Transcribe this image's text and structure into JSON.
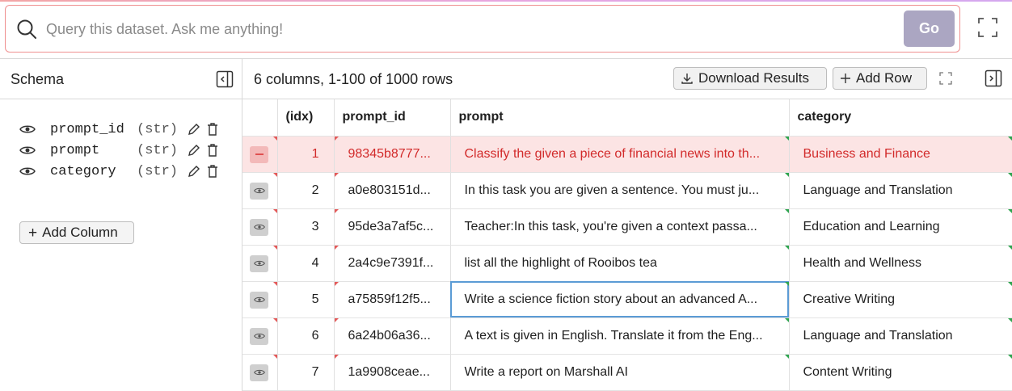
{
  "query": {
    "placeholder": "Query this dataset. Ask me anything!",
    "go_label": "Go"
  },
  "schema": {
    "title": "Schema",
    "columns": [
      {
        "name": "prompt_id",
        "type": "(str)"
      },
      {
        "name": "prompt",
        "type": "(str)"
      },
      {
        "name": "category",
        "type": "(str)"
      }
    ],
    "add_column_label": "Add Column"
  },
  "table": {
    "summary": "6 columns, 1-100 of 1000 rows",
    "download_label": "Download Results",
    "add_row_label": "Add Row",
    "headers": [
      "(idx)",
      "prompt_id",
      "prompt",
      "category"
    ],
    "rows": [
      {
        "idx": "1",
        "prompt_id": "98345b8777...",
        "prompt": "Classify the given a piece of financial news into th...",
        "category": "Business and Finance",
        "selected": true
      },
      {
        "idx": "2",
        "prompt_id": "a0e803151d...",
        "prompt": "In this task you are given a sentence. You must ju...",
        "category": "Language and Translation"
      },
      {
        "idx": "3",
        "prompt_id": "95de3a7af5c...",
        "prompt": "Teacher:In this task, you're given a context passa...",
        "category": "Education and Learning"
      },
      {
        "idx": "4",
        "prompt_id": "2a4c9e7391f...",
        "prompt": "list all the highlight of Rooibos tea",
        "category": "Health and Wellness"
      },
      {
        "idx": "5",
        "prompt_id": "a75859f12f5...",
        "prompt": "Write a science fiction story about an advanced A...",
        "category": "Creative Writing"
      },
      {
        "idx": "6",
        "prompt_id": "6a24b06a36...",
        "prompt": "A text is given in English. Translate it from the Eng...",
        "category": "Language and Translation"
      },
      {
        "idx": "7",
        "prompt_id": "1a9908ceae...",
        "prompt": "Write a report on Marshall AI",
        "category": "Content Writing"
      }
    ]
  },
  "colors": {
    "accent_go": "#aba6c2",
    "selected_row_bg": "#fce4e4",
    "selected_row_text": "#d22a2a",
    "query_border": "#ef8f8f"
  }
}
